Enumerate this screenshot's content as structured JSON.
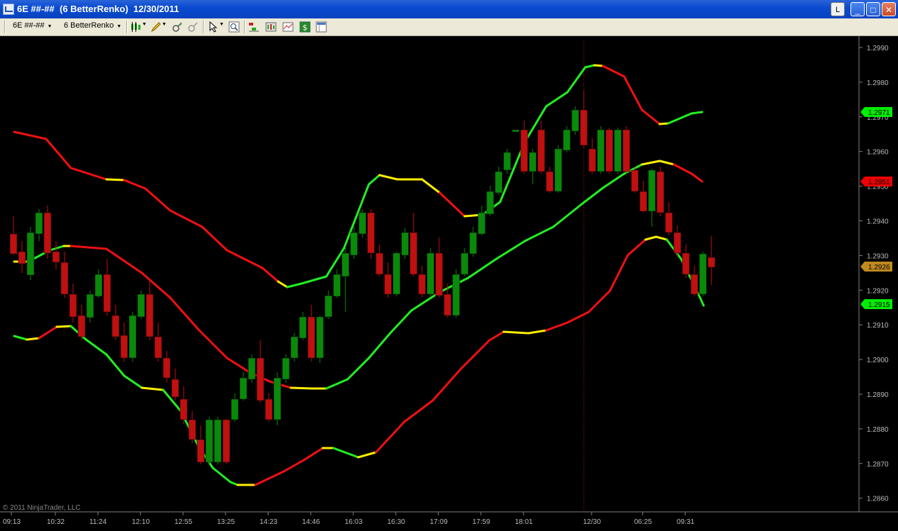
{
  "window": {
    "title": "6E ##-##  (6 BetterRenko)  12/30/2011",
    "btn_l": "L",
    "btn_min": "_",
    "btn_max": "□",
    "btn_close": "✕"
  },
  "toolbar": {
    "instrument": "6E ##-##",
    "bar_type": "6 BetterRenko",
    "icons": [
      "bar-style-icon",
      "drawing-pencil-icon",
      "zoom-in-icon",
      "zoom-out-icon",
      "cursor-icon",
      "find-icon",
      "indicators-icon",
      "strategies-icon",
      "chart-properties-icon",
      "dollar-icon",
      "data-box-icon"
    ]
  },
  "chart": {
    "copyright": "© 2011 NinjaTrader, LLC",
    "price_ticks": [
      "1.2990",
      "1.2980",
      "1.2970",
      "1.2960",
      "1.2950",
      "1.2940",
      "1.2930",
      "1.2920",
      "1.2910",
      "1.2900",
      "1.2890",
      "1.2880",
      "1.2870",
      "1.2860"
    ],
    "time_ticks": [
      "09:13",
      "10:32",
      "11:24",
      "12:10",
      "12:55",
      "13:25",
      "14:23",
      "14:46",
      "16:03",
      "16:30",
      "17:09",
      "17:59",
      "18:01",
      "12/30",
      "06:25",
      "09:31"
    ],
    "markers": [
      {
        "value": "1.2971",
        "color": "#00ee00"
      },
      {
        "value": "1.2951",
        "color": "#ee0000"
      },
      {
        "value": "1.2926",
        "color": "#c08a20"
      },
      {
        "value": "1.2915",
        "color": "#00ee00"
      }
    ],
    "colors": {
      "up": "#0a8a0a",
      "down": "#c01010",
      "band_green": "#22ee22",
      "band_red": "#ee1111",
      "band_yellow": "#ffee00",
      "background": "#000000"
    },
    "session_break_after_label": "12/30"
  }
}
